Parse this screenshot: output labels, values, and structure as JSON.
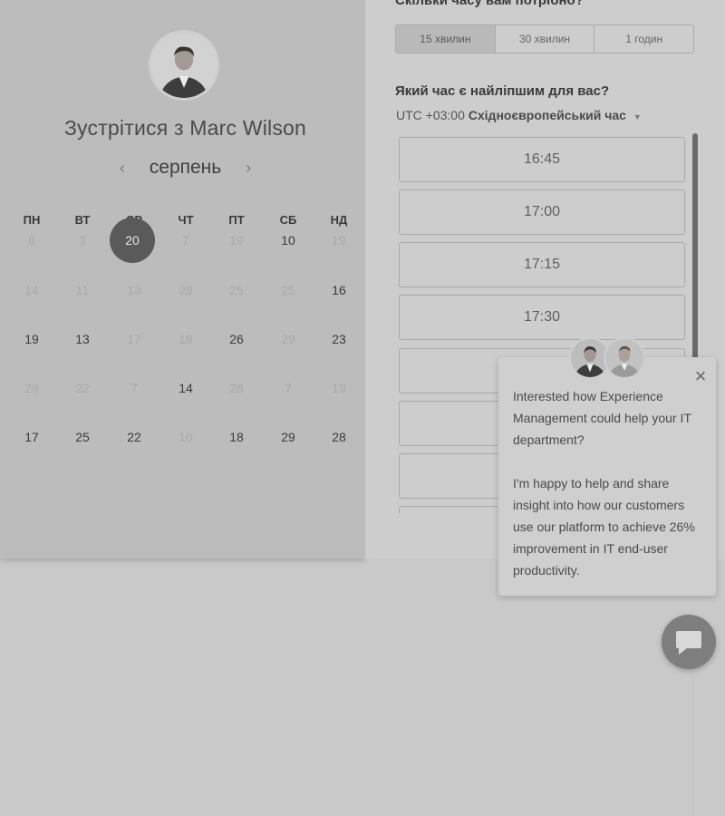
{
  "booking": {
    "title": "Зустрітися з Marc Wilson",
    "month": "серпень",
    "prev_arrow": "‹",
    "next_arrow": "›",
    "weekdays": [
      "ПН",
      "ВТ",
      "СР",
      "ЧТ",
      "ПТ",
      "СБ",
      "НД"
    ],
    "weeks": [
      [
        "8",
        "3",
        "20",
        "7",
        "19",
        "10",
        "19"
      ],
      [
        "14",
        "11",
        "13",
        "28",
        "25",
        "25",
        "16"
      ],
      [
        "19",
        "13",
        "17",
        "18",
        "26",
        "29",
        "23"
      ],
      [
        "29",
        "22",
        "7",
        "14",
        "28",
        "7",
        "19"
      ],
      [
        "17",
        "25",
        "22",
        "10",
        "18",
        "29",
        "28"
      ]
    ],
    "selected_day": "20",
    "duration_question": "Скільки часу вам потрібно?",
    "durations": [
      "15 хвилин",
      "30 хвилин",
      "1 годин"
    ],
    "active_duration": "15 хвилин",
    "time_question": "Який час є найліпшим для вас?",
    "timezone_offset": "UTC +03:00",
    "timezone_name": "Східноєвропейський час",
    "slots": [
      "16:45",
      "17:00",
      "17:15",
      "17:30",
      "",
      "",
      "",
      ""
    ]
  },
  "chat": {
    "close": "×",
    "message_1": "Interested how Experience Management could help your IT department?",
    "message_2": "I'm happy to help and share insight into how our customers use our platform to achieve 26% improvement in IT end-user productivity.",
    "open_button_icon": "chat-bubble-icon",
    "avatars": [
      "agent-avatar-1",
      "agent-avatar-2"
    ]
  },
  "colors": {
    "overlay_gray": "#c9c9c9",
    "selected_day": "#5a5a5a"
  }
}
